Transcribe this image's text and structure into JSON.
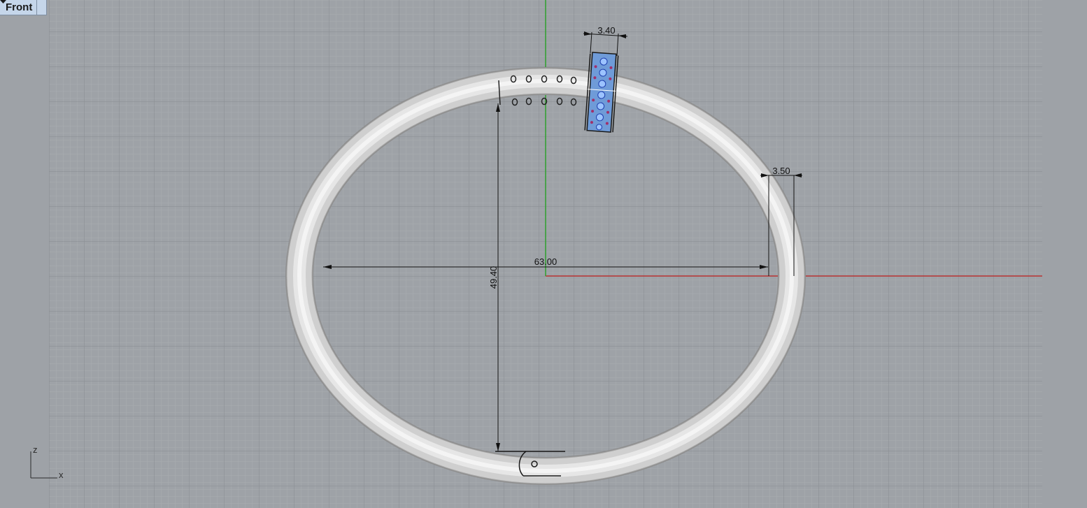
{
  "viewport": {
    "name": "Front",
    "menu_icon": "chevron-down-icon"
  },
  "dimensions": {
    "width": "63.00",
    "height": "49.40",
    "thickness": "3.50",
    "stone_width": "3.40"
  },
  "axes": {
    "vertical": "z",
    "horizontal": "x"
  },
  "colors": {
    "background": "#9ea2a7",
    "grid_minor": "#a9adb2",
    "grid_major": "#888c91",
    "x_axis": "#b83232",
    "z_axis": "#2ea02e",
    "tab_bg": "#c5d6ea",
    "band": "#d4d4d4",
    "stone": "#7aaef0"
  }
}
